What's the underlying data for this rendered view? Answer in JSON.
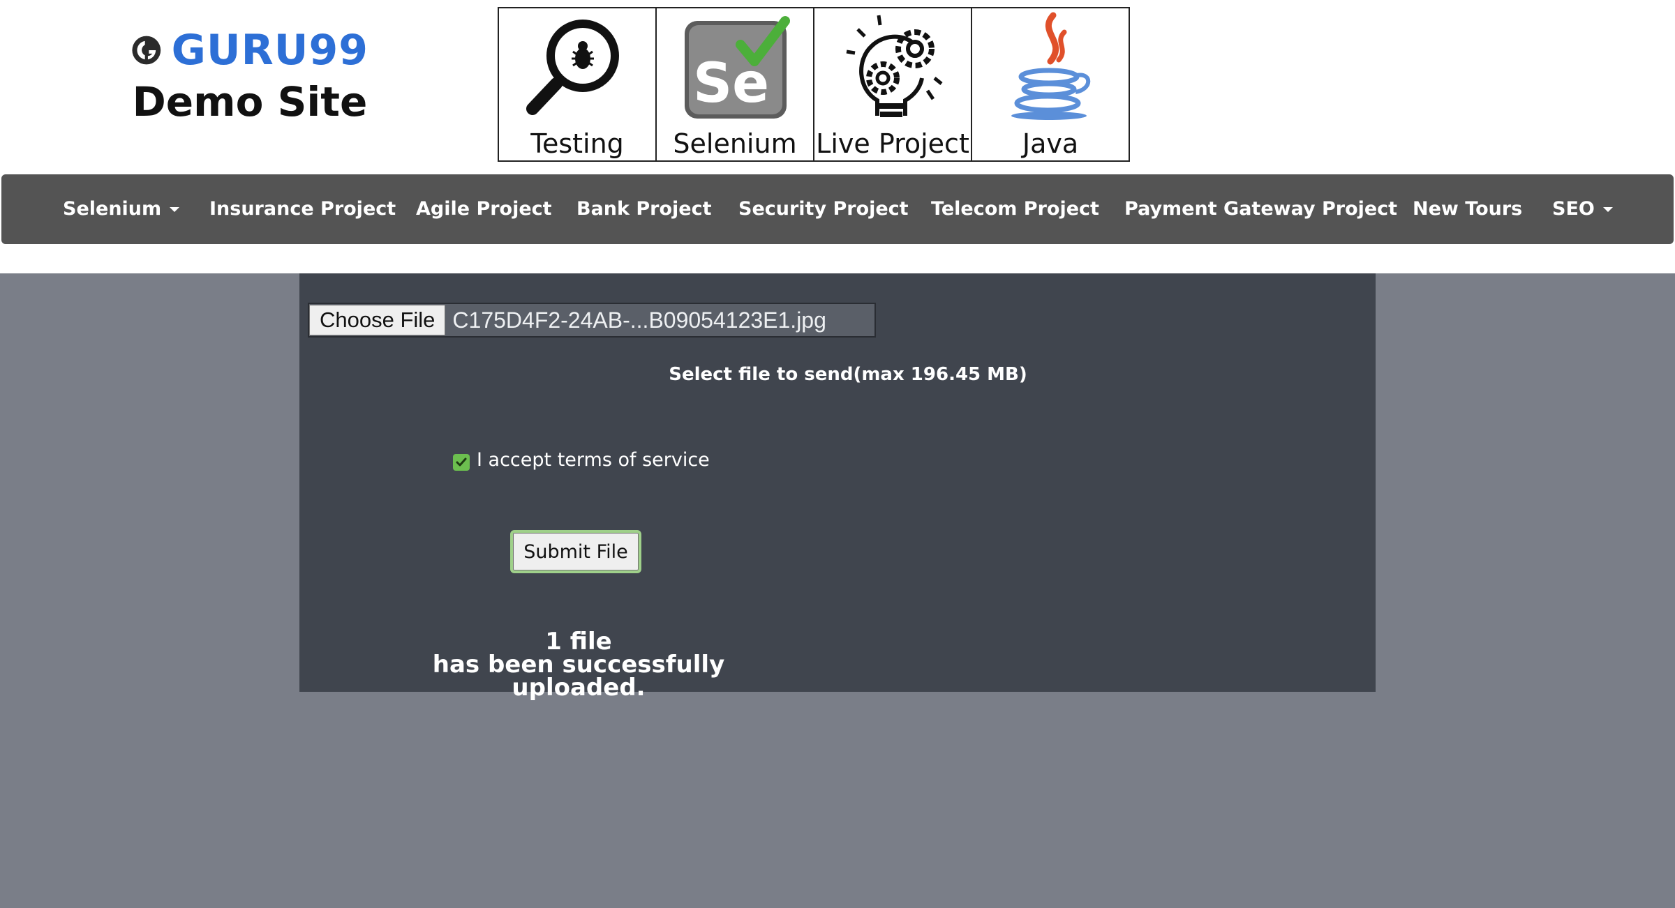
{
  "logo": {
    "brand": "GURU99",
    "subtitle": "Demo Site",
    "icon": "guru99-logo-icon"
  },
  "tiles": [
    {
      "label": "Testing",
      "icon": "magnifier-bug-icon"
    },
    {
      "label": "Selenium",
      "icon": "selenium-logo-icon"
    },
    {
      "label": "Live Project",
      "icon": "lightbulb-gears-icon"
    },
    {
      "label": "Java",
      "icon": "java-cup-icon"
    }
  ],
  "nav": {
    "items": [
      {
        "label": "Selenium",
        "dropdown": true
      },
      {
        "label": "Insurance Project",
        "dropdown": false
      },
      {
        "label": "Agile Project",
        "dropdown": false
      },
      {
        "label": "Bank Project",
        "dropdown": false
      },
      {
        "label": "Security Project",
        "dropdown": false
      },
      {
        "label": "Telecom Project",
        "dropdown": false
      },
      {
        "label": "Payment Gateway Project",
        "dropdown": false
      },
      {
        "label": "New Tours",
        "dropdown": false
      },
      {
        "label": "SEO",
        "dropdown": true
      }
    ]
  },
  "upload": {
    "choose_label": "Choose File",
    "file_name": "C175D4F2-24AB-...B09054123E1.jpg",
    "select_text": "Select file to send(max 196.45 MB)",
    "terms_label": "I accept terms of service",
    "terms_checked": true,
    "submit_label": "Submit File",
    "result_line1": "1 file",
    "result_line2": "has been successfully uploaded."
  },
  "colors": {
    "brand_blue": "#2d6fd6",
    "nav_bg": "#545454",
    "panel_bg": "#40454e",
    "page_bg": "#7a7e88",
    "checkbox_green": "#6cbf4f"
  }
}
